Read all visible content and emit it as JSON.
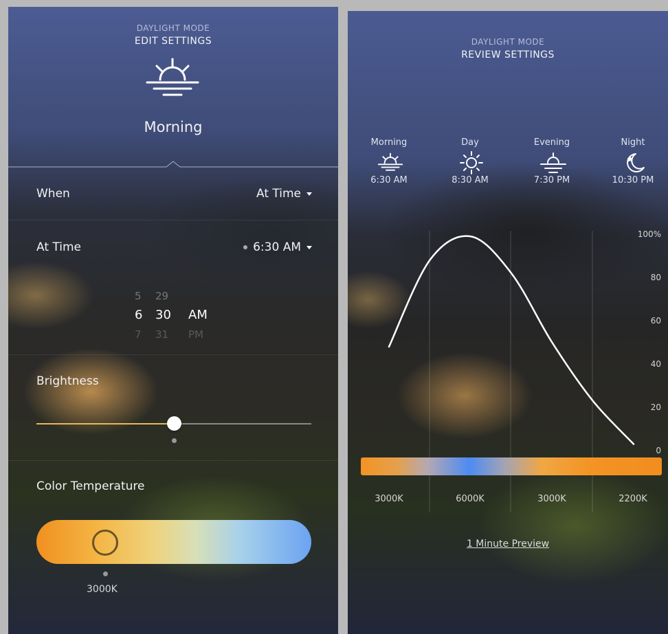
{
  "left": {
    "header_small": "DAYLIGHT MODE",
    "header_big": "EDIT SETTINGS",
    "period_icon": "sunrise-icon",
    "period_name": "Morning",
    "when_label": "When",
    "when_value": "At Time",
    "at_time_label": "At Time",
    "at_time_value": "6:30 AM",
    "picker": {
      "rows": [
        {
          "hour": "5",
          "minute": "29",
          "ampm": ""
        },
        {
          "hour": "6",
          "minute": "30",
          "ampm": "AM"
        },
        {
          "hour": "7",
          "minute": "31",
          "ampm": "PM"
        }
      ]
    },
    "brightness_label": "Brightness",
    "brightness_fraction": 0.5,
    "color_temp_label": "Color Temperature",
    "color_temp_value": "3000K",
    "color_temp_fraction": 0.25
  },
  "right": {
    "header_small": "DAYLIGHT MODE",
    "header_big": "REVIEW SETTINGS",
    "periods": [
      {
        "name": "Morning",
        "time": "6:30 AM",
        "icon": "sunrise-icon"
      },
      {
        "name": "Day",
        "time": "8:30 AM",
        "icon": "sun-icon"
      },
      {
        "name": "Evening",
        "time": "7:30 PM",
        "icon": "sunset-icon"
      },
      {
        "name": "Night",
        "time": "10:30 PM",
        "icon": "moon-star-icon"
      }
    ],
    "color_temps": [
      "3000K",
      "6000K",
      "3000K",
      "2200K"
    ],
    "preview_link": "1 Minute Preview"
  },
  "chart_data": {
    "type": "line",
    "title": "",
    "xlabel": "",
    "ylabel": "",
    "ylim": [
      0,
      100
    ],
    "yticks": [
      "100%",
      "80",
      "60",
      "40",
      "20",
      "0"
    ],
    "x": [
      0,
      0.5,
      1,
      1.5,
      2,
      2.5,
      3
    ],
    "series": [
      {
        "values": [
          48,
          88,
          99,
          82,
          50,
          23,
          3
        ]
      }
    ],
    "grid": "vertical",
    "line_color": "#ffffff"
  }
}
